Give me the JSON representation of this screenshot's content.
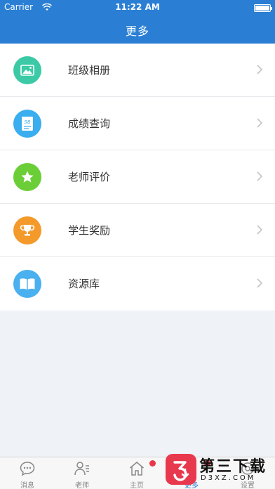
{
  "status": {
    "carrier": "Carrier",
    "time": "11:22 AM"
  },
  "nav": {
    "title": "更多"
  },
  "menu": [
    {
      "label": "班级相册",
      "icon": "photo-album-icon",
      "color": "#3ccaa6"
    },
    {
      "label": "成绩查询",
      "icon": "score-icon",
      "color": "#3aaeee",
      "badge_text": "98"
    },
    {
      "label": "老师评价",
      "icon": "star-icon",
      "color": "#6cce37"
    },
    {
      "label": "学生奖励",
      "icon": "trophy-icon",
      "color": "#f39a2b"
    },
    {
      "label": "资源库",
      "icon": "book-icon",
      "color": "#4ab0f0"
    }
  ],
  "tabs": [
    {
      "label": "消息",
      "icon": "chat-icon"
    },
    {
      "label": "老师",
      "icon": "teacher-icon"
    },
    {
      "label": "主页",
      "icon": "home-icon",
      "dot": true
    },
    {
      "label": "更多",
      "icon": "more-icon",
      "active": true,
      "dot": true
    },
    {
      "label": "设置",
      "icon": "settings-icon"
    }
  ],
  "watermark": {
    "text": "第三下载",
    "sub": "D3XZ.COM"
  },
  "colors": {
    "accent": "#2a7fd4",
    "background": "#eff2f6",
    "badge": "#e8364a"
  }
}
